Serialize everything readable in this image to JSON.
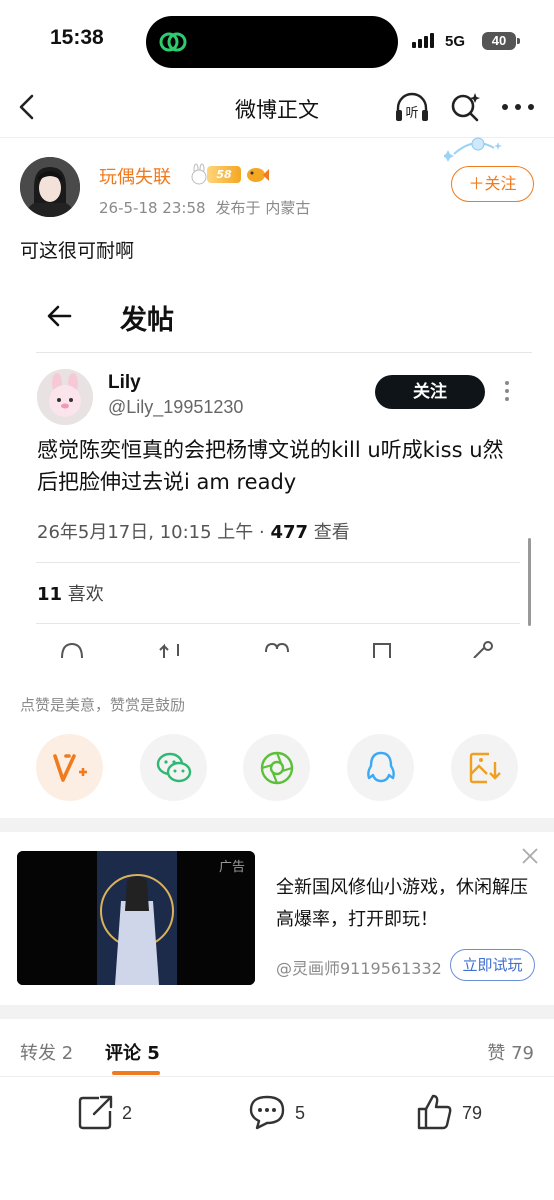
{
  "status_bar": {
    "time": "15:38",
    "network": "5G",
    "battery": "40"
  },
  "nav": {
    "title": "微博正文",
    "listen_label": "听"
  },
  "post": {
    "author": "玩偶失联",
    "level": "58",
    "date": "26-5-18 23:58",
    "location": "发布于 内蒙古",
    "follow_label": "＋关注",
    "text": "可这很可耐啊"
  },
  "embed": {
    "header_title": "发帖",
    "user_name": "Lily",
    "user_handle": "@Lily_19951230",
    "follow_label": "关注",
    "text": "感觉陈奕恒真的会把杨博文说的kill u听成kiss u然后把脸伸过去说i am ready",
    "date": "26年5月17日, 10:15 上午 · ",
    "views_count": "477",
    "views_label": " 查看",
    "likes_count": "11",
    "likes_label": " 喜欢"
  },
  "share": {
    "reward_text": "点赞是美意，赞赏是鼓励"
  },
  "ad": {
    "tag": "广告",
    "description": "全新国风修仙小游戏，休闲解压高爆率，打开即玩！",
    "source": "@灵画师9119561332",
    "cta": "立即试玩"
  },
  "tabs": {
    "repost": "转发 2",
    "comment": "评论 5",
    "like": "赞 79"
  },
  "actions": {
    "share_count": "2",
    "comment_count": "5",
    "like_count": "79"
  },
  "colors": {
    "accent": "#f07a1e",
    "link": "#3f6fd0"
  }
}
